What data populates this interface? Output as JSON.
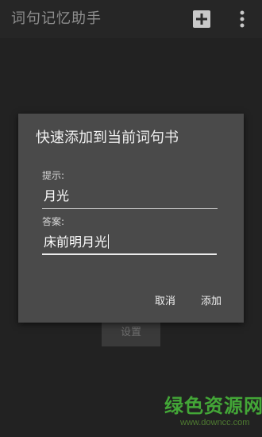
{
  "app": {
    "title": "词句记忆助手"
  },
  "toolbar": {
    "add_icon": "plus-icon",
    "more_icon": "more-vertical-icon"
  },
  "background": {
    "settings_label": "设置"
  },
  "dialog": {
    "title": "快速添加到当前词句书",
    "hint": {
      "label": "提示:",
      "value": "月光"
    },
    "answer": {
      "label": "答案:",
      "value": "床前明月光"
    },
    "cancel_label": "取消",
    "add_label": "添加"
  },
  "watermark": {
    "logo_text": "绿色资源网",
    "url": "www.downcc.com"
  },
  "colors": {
    "background": "#222222",
    "dialog": "#4a4a4a",
    "text_primary": "#f1f1f1",
    "watermark_green": "#43a637"
  }
}
